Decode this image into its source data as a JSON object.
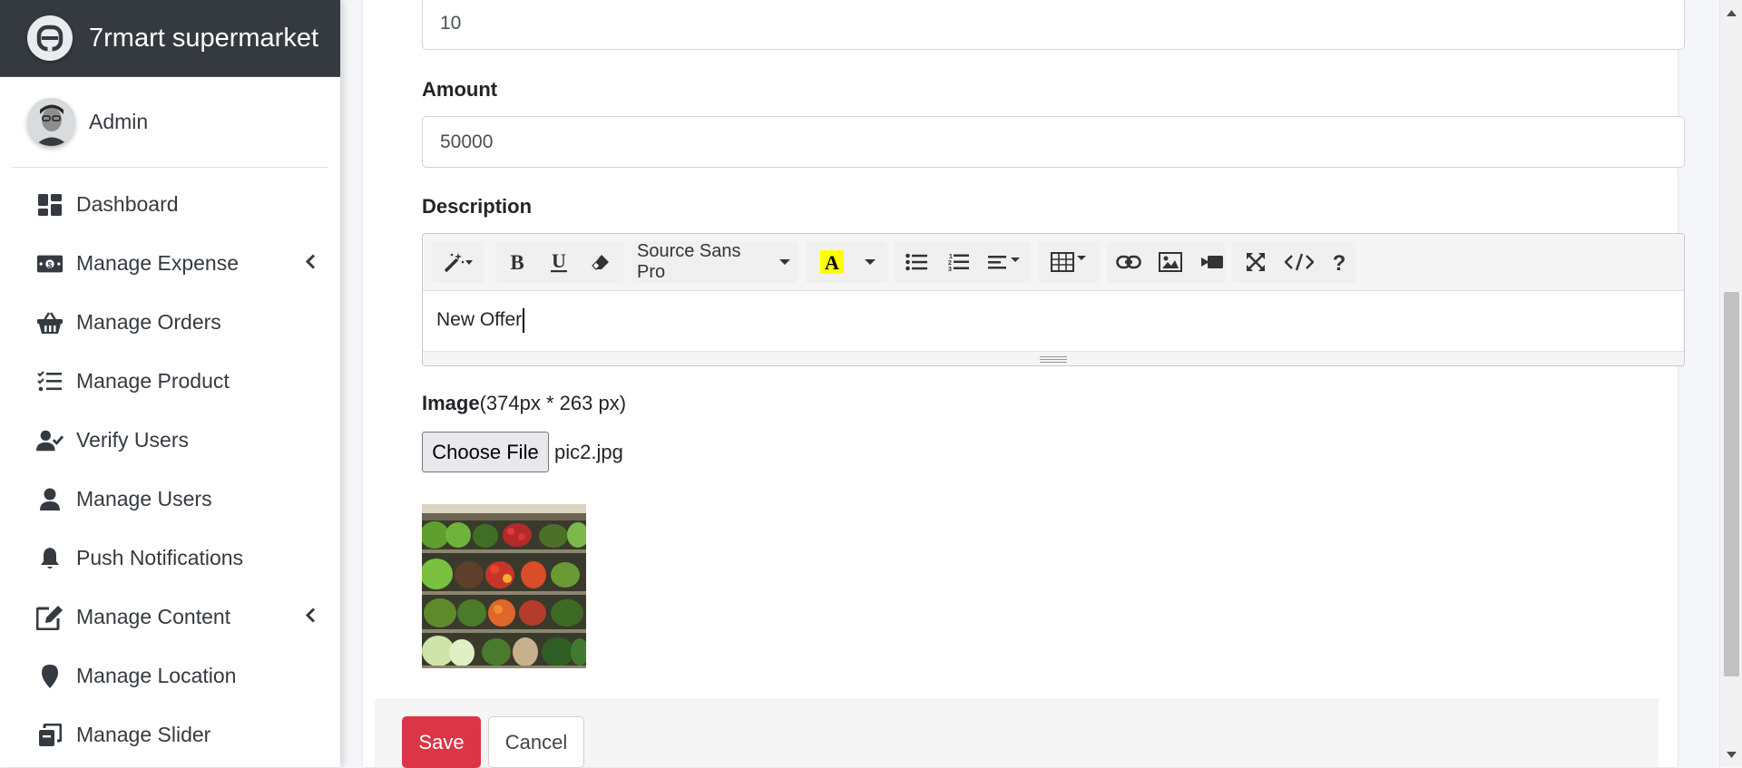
{
  "app": {
    "title": "7rmart supermarket"
  },
  "user": {
    "name": "Admin"
  },
  "sidebar": {
    "items": [
      {
        "label": "Dashboard",
        "icon": "dashboard-icon",
        "has_arrow": false
      },
      {
        "label": "Manage Expense",
        "icon": "money-bill-icon",
        "has_arrow": true
      },
      {
        "label": "Manage Orders",
        "icon": "basket-icon",
        "has_arrow": false
      },
      {
        "label": "Manage Product",
        "icon": "tasks-list-icon",
        "has_arrow": false
      },
      {
        "label": "Verify Users",
        "icon": "user-check-icon",
        "has_arrow": false
      },
      {
        "label": "Manage Users",
        "icon": "user-icon",
        "has_arrow": false
      },
      {
        "label": "Push Notifications",
        "icon": "bell-icon",
        "has_arrow": false
      },
      {
        "label": "Manage Content",
        "icon": "edit-icon",
        "has_arrow": true
      },
      {
        "label": "Manage Location",
        "icon": "map-marker-icon",
        "has_arrow": false
      },
      {
        "label": "Manage Slider",
        "icon": "clone-icon",
        "has_arrow": false
      }
    ]
  },
  "form": {
    "top_field_value": "10",
    "amount": {
      "label": "Amount",
      "value": "50000"
    },
    "description": {
      "label": "Description",
      "font_name": "Source Sans Pro",
      "content": "New Offer"
    },
    "image": {
      "label": "Image",
      "hint": "(374px * 263 px)",
      "choose_label": "Choose File",
      "file_name": "pic2.jpg"
    },
    "buttons": {
      "save": "Save",
      "cancel": "Cancel"
    }
  },
  "toolbar_tools": [
    "magic-wand-icon",
    "bold-icon",
    "underline-icon",
    "eraser-icon",
    "font-family-dropdown",
    "highlight-color-icon",
    "color-dropdown-icon",
    "unordered-list-icon",
    "ordered-list-icon",
    "paragraph-align-icon",
    "table-icon",
    "link-icon",
    "picture-icon",
    "video-icon",
    "fullscreen-icon",
    "code-view-icon",
    "help-icon"
  ],
  "colors": {
    "brand_bar": "#343a40",
    "save_button": "#dc3545",
    "sidebar_bg": "#ffffff",
    "page_bg": "#f4f6f9"
  }
}
